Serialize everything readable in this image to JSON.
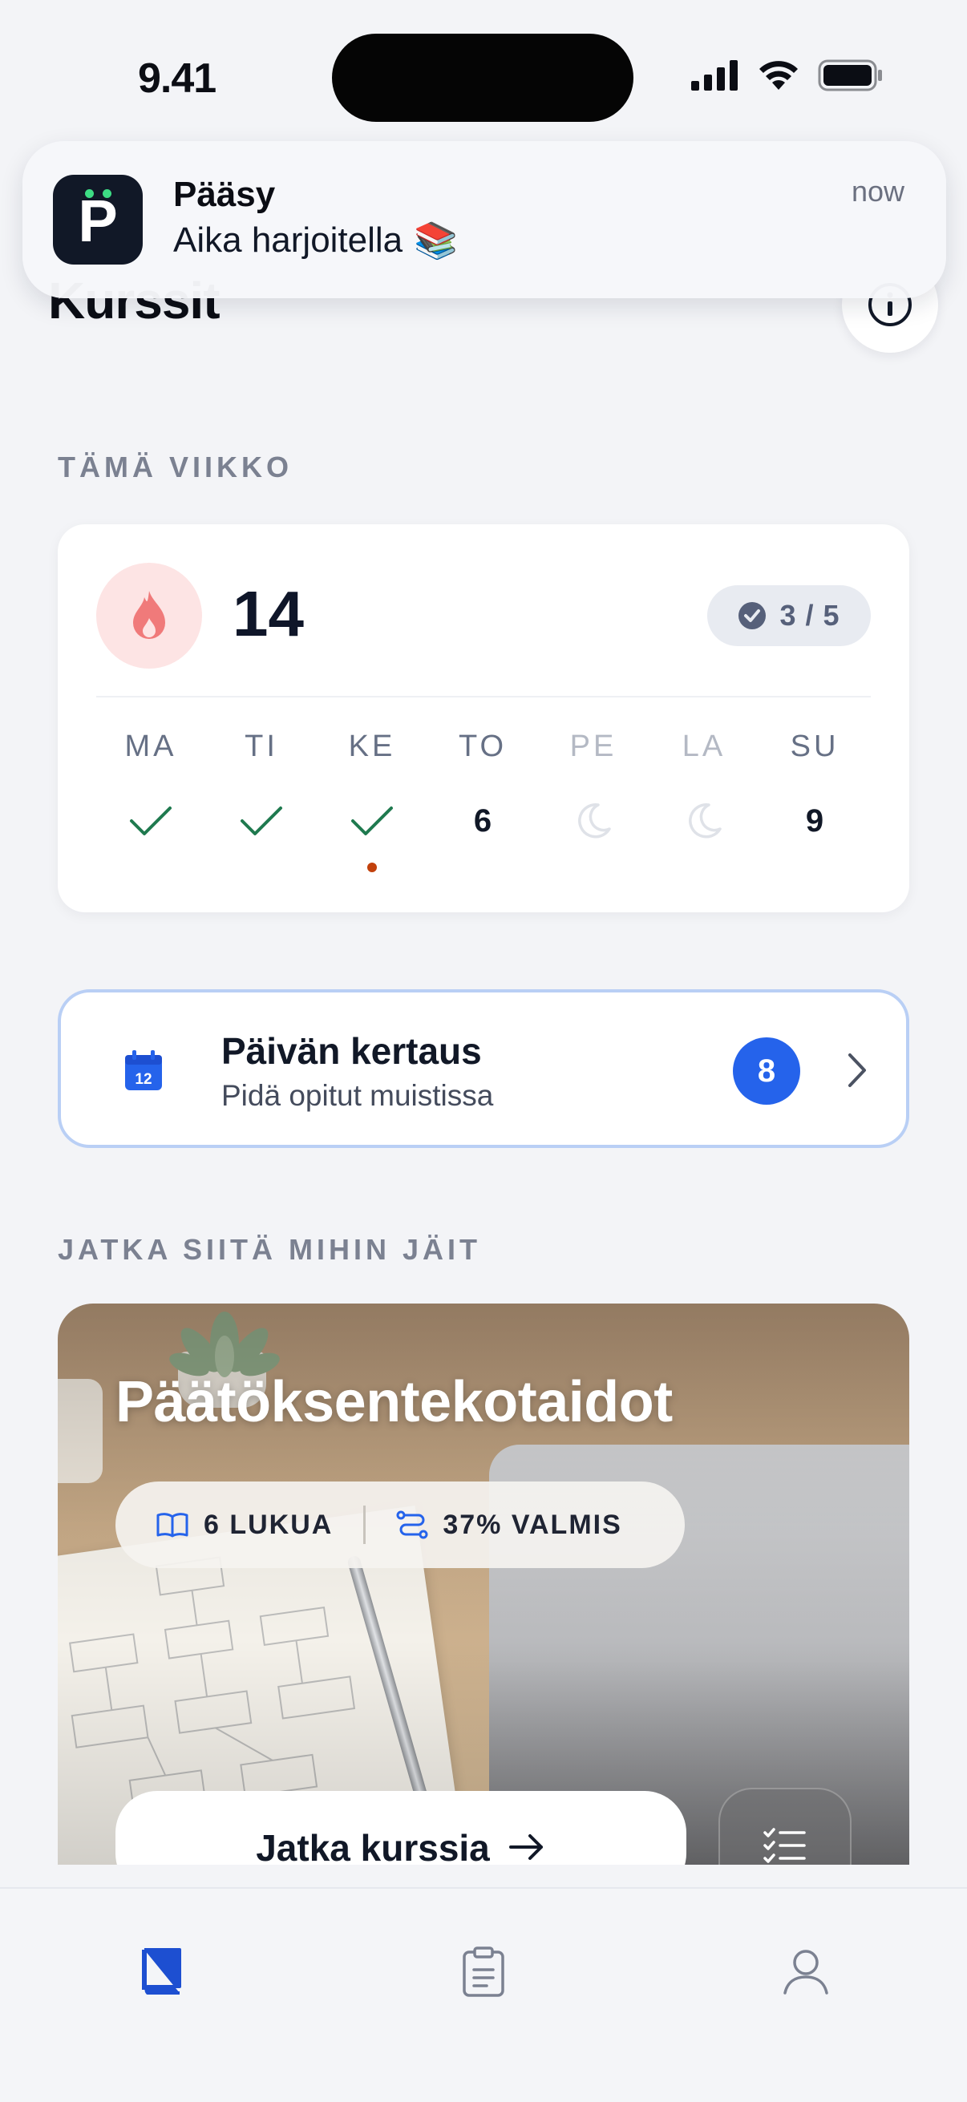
{
  "status_bar": {
    "time": "9.41"
  },
  "header": {
    "title": "Kurssit"
  },
  "notification": {
    "app_name": "Pääsy",
    "app_icon_letter": "P",
    "message": "Aika harjoitella",
    "emoji": "📚",
    "time": "now"
  },
  "week": {
    "section_label": "TÄMÄ VIIKKO",
    "streak": "14",
    "goal": "3 / 5",
    "days": [
      {
        "label": "MA",
        "state": "done",
        "value": ""
      },
      {
        "label": "TI",
        "state": "done",
        "value": ""
      },
      {
        "label": "KE",
        "state": "done",
        "value": ""
      },
      {
        "label": "TO",
        "state": "number",
        "value": "6"
      },
      {
        "label": "PE",
        "state": "rest",
        "value": ""
      },
      {
        "label": "LA",
        "state": "rest",
        "value": ""
      },
      {
        "label": "SU",
        "state": "number",
        "value": "9"
      }
    ],
    "today_index": 2
  },
  "review": {
    "title": "Päivän kertaus",
    "subtitle": "Pidä opitut muistissa",
    "count": "8",
    "calendar_day": "12"
  },
  "continue": {
    "section_label": "JATKA SIITÄ MIHIN JÄIT",
    "course_title": "Päätöksentekotaidot",
    "chapters": "6 LUKUA",
    "progress": "37% VALMIS",
    "button_label": "Jatka kurssia"
  },
  "tabs": [
    {
      "name": "courses",
      "icon": "book-icon",
      "active": true
    },
    {
      "name": "assignments",
      "icon": "clipboard-icon",
      "active": false
    },
    {
      "name": "profile",
      "icon": "profile-icon",
      "active": false
    }
  ],
  "colors": {
    "accent": "#2563eb",
    "check": "#1f7a4f",
    "flame": "#f07a7a",
    "today_dot": "#c2410c",
    "muted": "#b4b9c4"
  }
}
